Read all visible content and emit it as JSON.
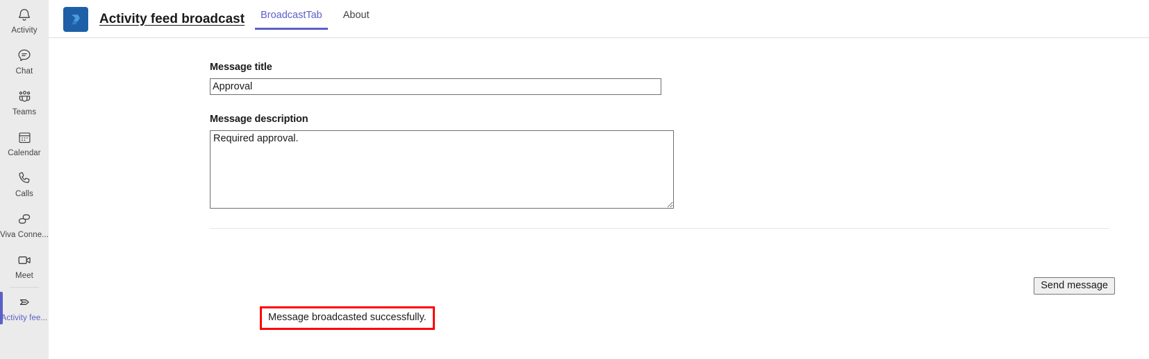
{
  "rail": {
    "items": [
      {
        "label": "Activity",
        "icon": "bell-icon",
        "active": false
      },
      {
        "label": "Chat",
        "icon": "chat-bubble-icon",
        "active": false
      },
      {
        "label": "Teams",
        "icon": "teams-people-icon",
        "active": false
      },
      {
        "label": "Calendar",
        "icon": "calendar-icon",
        "active": false
      },
      {
        "label": "Calls",
        "icon": "phone-icon",
        "active": false
      },
      {
        "label": "Viva Conne...",
        "icon": "viva-connections-icon",
        "active": false
      },
      {
        "label": "Meet",
        "icon": "video-camera-icon",
        "active": false
      },
      {
        "label": "Activity fee...",
        "icon": "broadcast-send-icon",
        "active": true
      }
    ],
    "active_color": "#5b5fc7"
  },
  "header": {
    "app_icon": "activity-feed-broadcast-app-icon",
    "app_icon_color": "#1e5fa8",
    "title": "Activity feed broadcast",
    "tabs": [
      {
        "label": "BroadcastTab",
        "active": true
      },
      {
        "label": "About",
        "active": false
      }
    ],
    "active_tab_color": "#5b5fc7"
  },
  "form": {
    "title_field": {
      "label": "Message title",
      "value": "Approval",
      "placeholder": ""
    },
    "description_field": {
      "label": "Message description",
      "value": "Required approval.",
      "placeholder": ""
    }
  },
  "actions": {
    "send_label": "Send message"
  },
  "status": {
    "text": "Message broadcasted successfully.",
    "highlight_color": "#ff0000"
  }
}
